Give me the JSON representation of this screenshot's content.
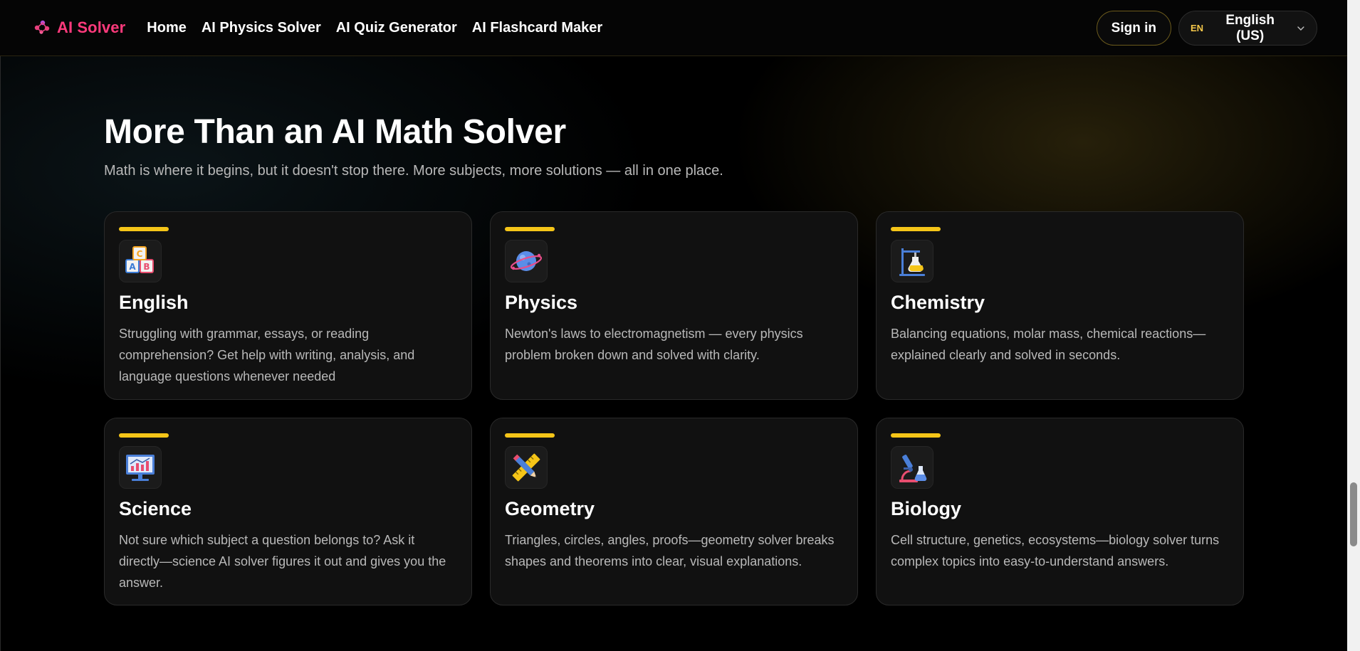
{
  "header": {
    "logo_text": "AI Solver",
    "nav": [
      {
        "label": "Home"
      },
      {
        "label": "AI Physics Solver"
      },
      {
        "label": "AI Quiz Generator"
      },
      {
        "label": "AI Flashcard Maker"
      }
    ],
    "signin_label": "Sign in",
    "language": {
      "code": "EN",
      "label": "English (US)"
    }
  },
  "section": {
    "title": "More Than an AI Math Solver",
    "subtitle": "Math is where it begins, but it doesn't stop there. More subjects, more solutions — all in one place."
  },
  "cards": [
    {
      "icon": "abc-blocks-icon",
      "title": "English",
      "description": "Struggling with grammar, essays, or reading comprehension? Get help with writing, analysis, and language questions whenever needed"
    },
    {
      "icon": "planet-icon",
      "title": "Physics",
      "description": "Newton's laws to electromagnetism — every physics problem broken down and solved with clarity."
    },
    {
      "icon": "lab-flask-icon",
      "title": "Chemistry",
      "description": "Balancing equations, molar mass, chemical reactions—explained clearly and solved in seconds."
    },
    {
      "icon": "monitor-chart-icon",
      "title": "Science",
      "description": "Not sure which subject a question belongs to? Ask it directly—science AI solver figures it out and gives you the answer."
    },
    {
      "icon": "ruler-pencil-icon",
      "title": "Geometry",
      "description": "Triangles, circles, angles, proofs—geometry solver breaks shapes and theorems into clear, visual explanations."
    },
    {
      "icon": "microscope-icon",
      "title": "Biology",
      "description": "Cell structure, genetics, ecosystems—biology solver turns complex topics into easy-to-understand answers."
    }
  ],
  "colors": {
    "brand": "#ff3a7c",
    "accent": "#f5c518",
    "background": "#000000",
    "card": "#111111"
  }
}
